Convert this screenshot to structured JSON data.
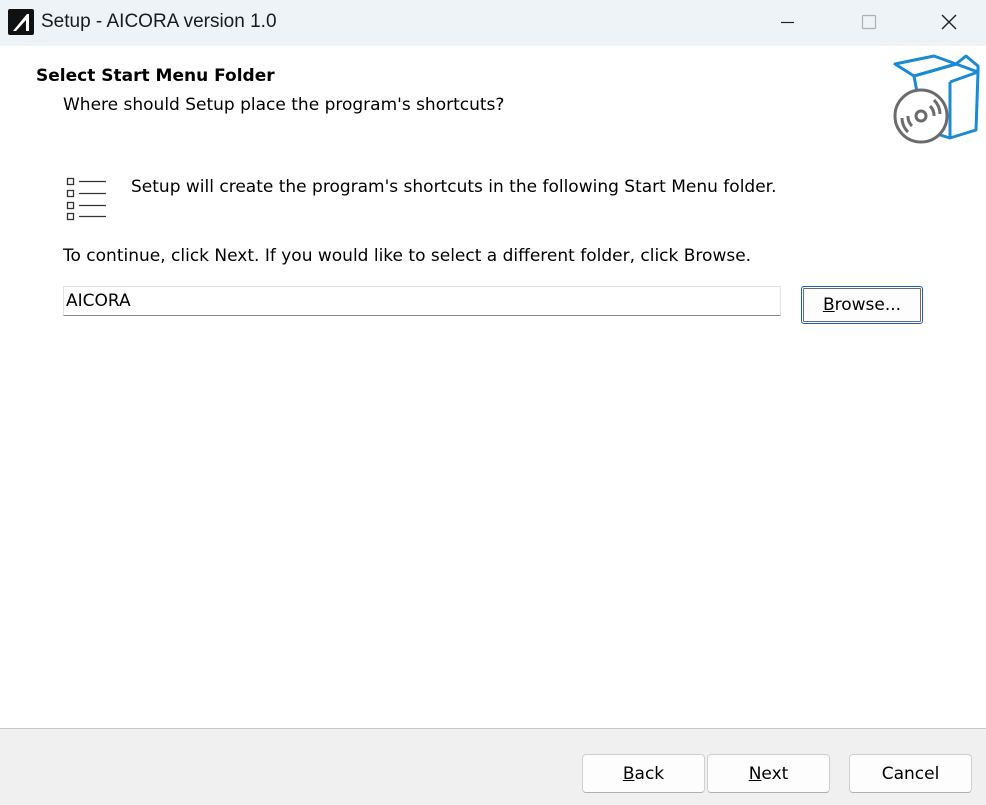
{
  "window": {
    "title": "Setup - AICORA version 1.0",
    "controls": {
      "minimize": "minimize",
      "maximize": "maximize",
      "close": "close"
    }
  },
  "header": {
    "title": "Select Start Menu Folder",
    "subtitle": "Where should Setup place the program's shortcuts?",
    "icon": "setup-box-cd-icon"
  },
  "content": {
    "info_text": "Setup will create the program's shortcuts in the following Start Menu folder.",
    "continue_text": "To continue, click Next. If you would like to select a different folder, click Browse.",
    "folder_value": "AICORA",
    "browse_label_accel": "B",
    "browse_label_rest": "rowse..."
  },
  "footer": {
    "back_accel": "B",
    "back_rest": "ack",
    "next_accel": "N",
    "next_rest": "ext",
    "cancel_label": "Cancel"
  },
  "colors": {
    "accent": "#1a8ad4",
    "titlebar": "#eef3f8",
    "footer": "#f0f0f0"
  }
}
